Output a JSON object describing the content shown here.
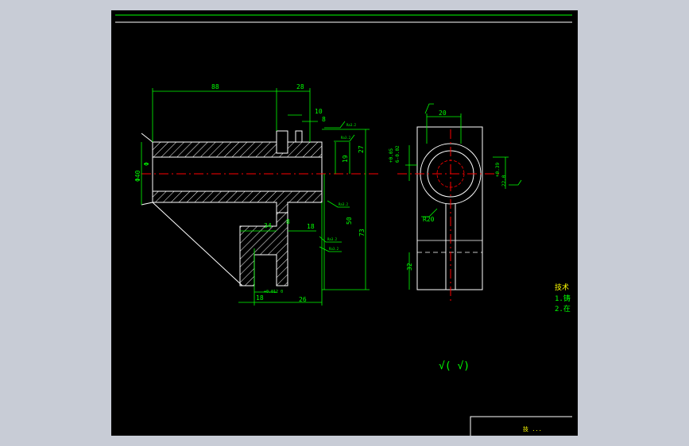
{
  "colors": {
    "background": "#c8ccd6",
    "sheet": "#000000",
    "outline": "#ffffff",
    "dimension": "#00ff00",
    "centerline": "#ff0000",
    "hatch": "#ffffff",
    "annotation": "#ffff00"
  },
  "front_view": {
    "dims": {
      "top_len": "88",
      "top_right": "28",
      "step_small": "10",
      "step_gap": "10",
      "step_tiny": "8",
      "h_total": "27",
      "h_upper": "19",
      "h_mid": "50",
      "h_overall": "73",
      "dia_bore": "Φ40",
      "dia_inner": "Φ",
      "arm_w": "34",
      "arm_gap": "8",
      "arm_18": "18",
      "slot_w": "18",
      "slot_tol": "+0.012\n0",
      "base_26": "26"
    },
    "roughness": "Ra3.2"
  },
  "side_view": {
    "dims": {
      "top_20": "20",
      "tol_left": "+0.05",
      "tol_left2": "6-0.02",
      "radius": "R20",
      "tol_right": "+0.39",
      "tol_right2": "22.0",
      "h_32": "32"
    }
  },
  "notes": {
    "title": "技术",
    "line1": "1.铸",
    "line2": "2.在"
  },
  "roughness_symbol": "√( √)",
  "title_block_text": "技 ..."
}
